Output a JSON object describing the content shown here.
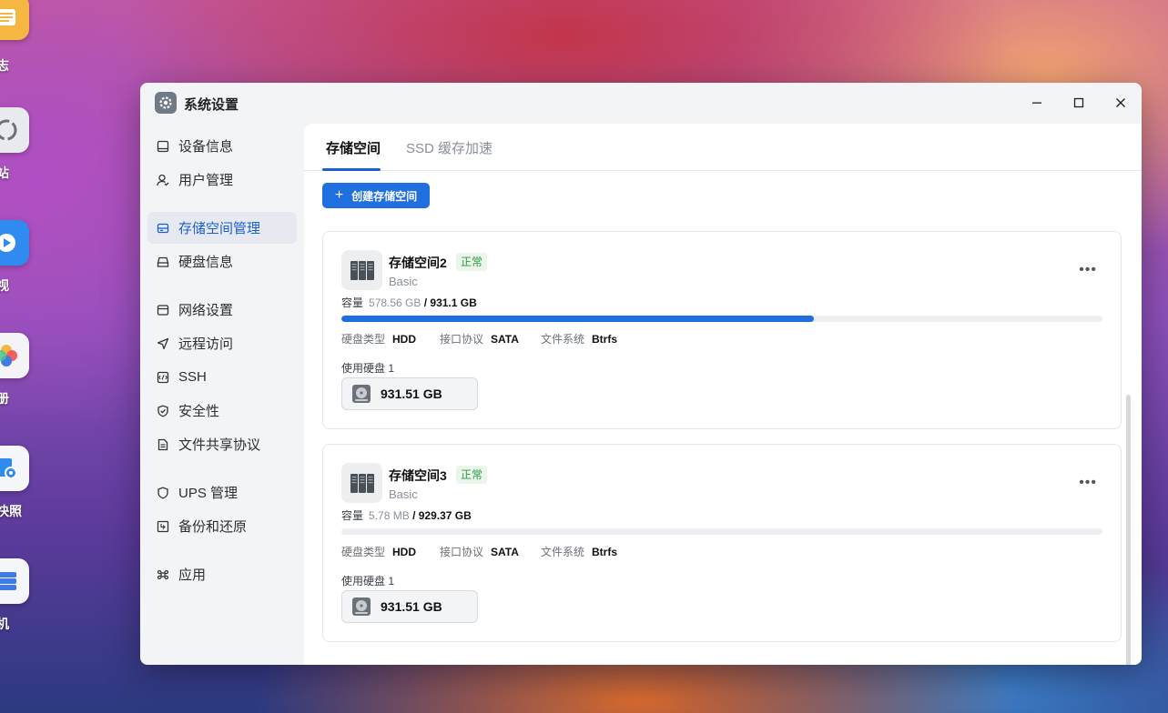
{
  "desktop": {
    "icons": [
      {
        "label": "日志",
        "color": "#f5b642"
      },
      {
        "label": "收站",
        "color": "#e8eaee"
      },
      {
        "label": "影视",
        "color": "#2f8bf0"
      },
      {
        "label": "相册",
        "color": "#f4f4f6"
      },
      {
        "label": "件快照",
        "color": "#2f8bf0"
      },
      {
        "label": "拟机",
        "color": "#3f7ae8"
      }
    ]
  },
  "window": {
    "title": "系统设置",
    "controls": {
      "minimize": "minimize-icon",
      "maximize": "maximize-icon",
      "close": "close-icon"
    }
  },
  "sidebar": {
    "items": [
      {
        "label": "设备信息",
        "icon": "device-icon"
      },
      {
        "label": "用户管理",
        "icon": "user-icon"
      },
      {
        "label": "存储空间管理",
        "icon": "storage-icon",
        "active": true
      },
      {
        "label": "硬盘信息",
        "icon": "disk-icon"
      },
      {
        "label": "网络设置",
        "icon": "network-icon"
      },
      {
        "label": "远程访问",
        "icon": "remote-icon"
      },
      {
        "label": "SSH",
        "icon": "ssh-icon"
      },
      {
        "label": "安全性",
        "icon": "shield-check-icon"
      },
      {
        "label": "文件共享协议",
        "icon": "file-share-icon"
      },
      {
        "label": "UPS 管理",
        "icon": "ups-icon"
      },
      {
        "label": "备份和还原",
        "icon": "backup-icon"
      },
      {
        "label": "应用",
        "icon": "apps-icon"
      }
    ]
  },
  "tabs": [
    {
      "label": "存储空间",
      "active": true
    },
    {
      "label": "SSD 缓存加速",
      "active": false
    }
  ],
  "create_button": {
    "label": "创建存储空间"
  },
  "storage_pools": [
    {
      "name": "存储空间2",
      "status": "正常",
      "type": "Basic",
      "capacity_label": "容量",
      "used": "578.56 GB",
      "total": "/ 931.1 GB",
      "usage_fraction": 0.621,
      "disk_type_label": "硬盘类型",
      "disk_type": "HDD",
      "interface_label": "接口协议",
      "interface": "SATA",
      "fs_label": "文件系统",
      "fs": "Btrfs",
      "disks_label": "使用硬盘 1",
      "disk_size": "931.51 GB"
    },
    {
      "name": "存储空间3",
      "status": "正常",
      "type": "Basic",
      "capacity_label": "容量",
      "used": "5.78 MB",
      "total": "/ 929.37 GB",
      "usage_fraction": 0.0,
      "disk_type_label": "硬盘类型",
      "disk_type": "HDD",
      "interface_label": "接口协议",
      "interface": "SATA",
      "fs_label": "文件系统",
      "fs": "Btrfs",
      "disks_label": "使用硬盘 1",
      "disk_size": "931.51 GB"
    }
  ],
  "colors": {
    "accent": "#1f6fde",
    "status_ok": "#2f9a3e"
  }
}
